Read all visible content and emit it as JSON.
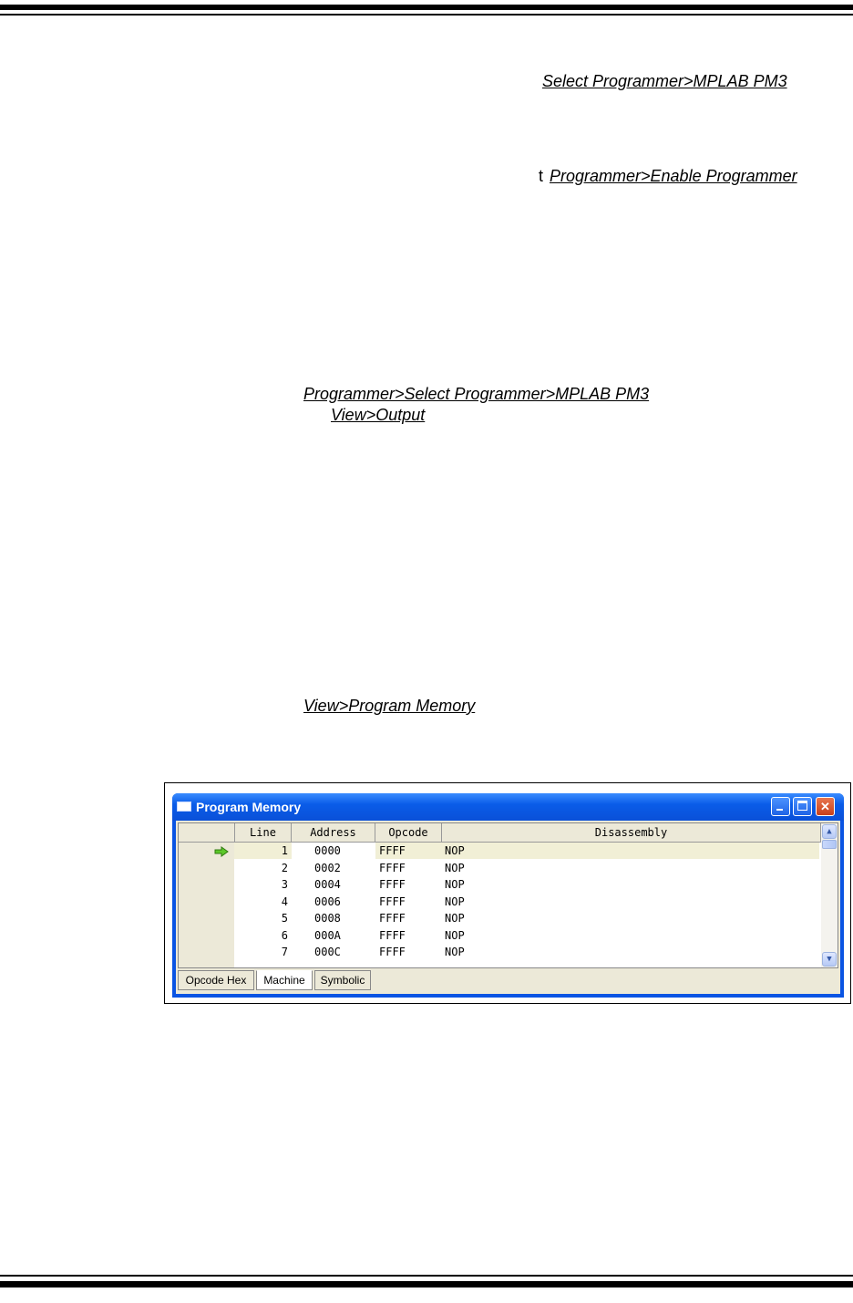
{
  "links": {
    "select_programmer": "Select Programmer>MPLAB PM3",
    "enable_prefix": "t",
    "enable_programmer": "Programmer>Enable Programmer",
    "programmer_select": "Programmer>Select Programmer>MPLAB PM3",
    "view_output": "View>Output",
    "view_program_memory": "View>Program Memory"
  },
  "window": {
    "title": "Program Memory",
    "columns": [
      "Line",
      "Address",
      "Opcode",
      "Disassembly"
    ],
    "rows": [
      {
        "line": "1",
        "address": "0000",
        "opcode": "FFFF",
        "disassembly": "NOP"
      },
      {
        "line": "2",
        "address": "0002",
        "opcode": "FFFF",
        "disassembly": "NOP"
      },
      {
        "line": "3",
        "address": "0004",
        "opcode": "FFFF",
        "disassembly": "NOP"
      },
      {
        "line": "4",
        "address": "0006",
        "opcode": "FFFF",
        "disassembly": "NOP"
      },
      {
        "line": "5",
        "address": "0008",
        "opcode": "FFFF",
        "disassembly": "NOP"
      },
      {
        "line": "6",
        "address": "000A",
        "opcode": "FFFF",
        "disassembly": "NOP"
      },
      {
        "line": "7",
        "address": "000C",
        "opcode": "FFFF",
        "disassembly": "NOP"
      }
    ],
    "tabs": [
      "Opcode Hex",
      "Machine",
      "Symbolic"
    ],
    "active_tab": "Machine"
  }
}
